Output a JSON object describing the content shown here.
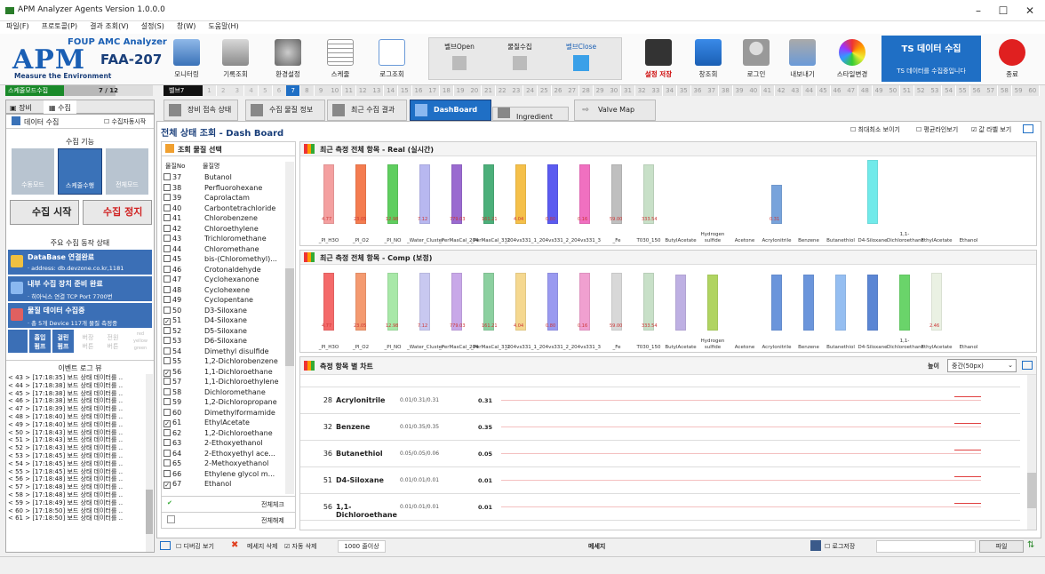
{
  "window": {
    "title": "APM Analyzer Agents Version 1.0.0.0"
  },
  "menu": [
    "파일(F)",
    "프로토콜(P)",
    "결과 조회(V)",
    "설정(S)",
    "창(W)",
    "도움말(H)"
  ],
  "logo": {
    "brand": "APM",
    "foup": "FOUP AMC Analyzer",
    "model": "FAA-207",
    "tagline": "Measure the Environment"
  },
  "toolbar": {
    "monitoring": "모니터링",
    "record": "기록조회",
    "env": "환경설정",
    "schedule": "스케줄",
    "log": "로그조회",
    "valve_open": "벨브Open",
    "mat_collect": "물질수집",
    "valve_close": "벨브Close",
    "save": "설정 저장",
    "window": "창조회",
    "login": "로그인",
    "export": "내보내기",
    "style": "스타일변경",
    "exit": "종료"
  },
  "ts": {
    "title": "TS 데이터 수집",
    "status": "TS 데이터를 수집중입니다"
  },
  "progress": {
    "mode": "스케줄모드수집",
    "count": "7 / 12",
    "fraction": 0.583,
    "valve_label": "벨브7"
  },
  "steps": [
    "1",
    "2",
    "3",
    "4",
    "5",
    "6",
    "7",
    "8",
    "9",
    "10",
    "11",
    "12",
    "13",
    "14",
    "15",
    "16",
    "17",
    "18",
    "19",
    "20",
    "21",
    "22",
    "23",
    "24",
    "25",
    "26",
    "27",
    "28",
    "29",
    "30",
    "31",
    "32",
    "33",
    "34",
    "35",
    "36",
    "37",
    "38",
    "39",
    "40",
    "41",
    "42",
    "43",
    "44",
    "45",
    "46",
    "47",
    "48",
    "49",
    "50",
    "51",
    "52",
    "53",
    "54",
    "55",
    "56",
    "57",
    "58",
    "59",
    "60"
  ],
  "active_step": "7",
  "left_tabs": [
    "장비",
    "수집"
  ],
  "left": {
    "collect_title": "데이터 수집",
    "auto_collect": "수집자동시작",
    "func_title": "수집 기능",
    "modes": [
      "수동모드",
      "스케줄수행",
      "전체모드"
    ],
    "start": "수집 시작",
    "stop": "수집 정지",
    "status_title": "주요 수집 동작 상태",
    "status": [
      {
        "h": "DataBase 연결완료",
        "s": "· address: db.devzone.co.kr,1181"
      },
      {
        "h": "내부 수집 장치 준비 완료",
        "s": "· 히아닉스 연결 TCP Port 7700번"
      },
      {
        "h": "물질 데이터 수집중",
        "s": "· 총 5개 Device 117개 물질 측정중"
      }
    ],
    "pumps": [
      "흡입\n펌프",
      "걸린\n펌프",
      "버장\n버튼",
      "전원\n버튼"
    ],
    "pump_tags": [
      "red",
      "yellow",
      "green"
    ],
    "log_title": "이벤트 로그 뷰",
    "logs": [
      "< 43 > [17:18:35] 보드 상태 데이터를 ..",
      "< 44 > [17:18:38] 보드 상태 데이터를 ..",
      "< 45 > [17:18:38] 보드 상태 데이터를 ..",
      "< 46 > [17:18:38] 보드 상태 데이터를 ..",
      "< 47 > [17:18:39] 보드 상태 데이터를 ..",
      "< 48 > [17:18:40] 보드 상태 데이터를 ..",
      "< 49 > [17:18:40] 보드 상태 데이터를 ..",
      "< 50 > [17:18:43] 보드 상태 데이터를 ..",
      "< 51 > [17:18:43] 보드 상태 데이터를 ..",
      "< 52 > [17:18:43] 보드 상태 데이터를 ..",
      "< 53 > [17:18:45] 보드 상태 데이터를 ..",
      "< 54 > [17:18:45] 보드 상태 데이터를 ..",
      "< 55 > [17:18:45] 보드 상태 데이터를 ..",
      "< 56 > [17:18:48] 보드 상태 데이터를 ..",
      "< 57 > [17:18:48] 보드 상태 데이터를 ..",
      "< 58 > [17:18:48] 보드 상태 데이터를 ..",
      "< 59 > [17:18:49] 보드 상태 데이터를 ..",
      "< 60 > [17:18:50] 보드 상태 데이터를 ..",
      "< 61 > [17:18:50] 보드 상태 데이터를 .."
    ]
  },
  "tabs": [
    "장비 접속 상태",
    "수집 물질 정보",
    "최근 수집 결과",
    "DashBoard",
    "Ingredient",
    "Valve Map"
  ],
  "dash": {
    "title": "전체 상태 조회 - Dash Board",
    "opt_minmax": "최대최소 보이기",
    "opt_avg": "평균라인보기",
    "opt_value": "값 라벨 보기"
  },
  "materials": {
    "title": "조회 물질 선택",
    "col_no": "물질No",
    "col_name": "물질명",
    "check_all": "전체체크",
    "uncheck_all": "전체해제",
    "rows": [
      {
        "no": "37",
        "name": "Butanol",
        "c": false
      },
      {
        "no": "38",
        "name": "Perfluorohexane",
        "c": false
      },
      {
        "no": "39",
        "name": "Caprolactam",
        "c": false
      },
      {
        "no": "40",
        "name": "Carbontetrachloride",
        "c": false
      },
      {
        "no": "41",
        "name": "Chlorobenzene",
        "c": false
      },
      {
        "no": "42",
        "name": "Chloroethylene",
        "c": false
      },
      {
        "no": "43",
        "name": "Trichloromethane",
        "c": false
      },
      {
        "no": "44",
        "name": "Chloromethane",
        "c": false
      },
      {
        "no": "45",
        "name": "bis-(Chloromethyl)...",
        "c": false
      },
      {
        "no": "46",
        "name": "Crotonaldehyde",
        "c": false
      },
      {
        "no": "47",
        "name": "Cyclohexanone",
        "c": false
      },
      {
        "no": "48",
        "name": "Cyclohexene",
        "c": false
      },
      {
        "no": "49",
        "name": "Cyclopentane",
        "c": false
      },
      {
        "no": "50",
        "name": "D3-Siloxane",
        "c": false
      },
      {
        "no": "51",
        "name": "D4-Siloxane",
        "c": true
      },
      {
        "no": "52",
        "name": "D5-Siloxane",
        "c": false
      },
      {
        "no": "53",
        "name": "D6-Siloxane",
        "c": false
      },
      {
        "no": "54",
        "name": "Dimethyl disulfide",
        "c": false
      },
      {
        "no": "55",
        "name": "1,2-Dichlorobenzene",
        "c": false
      },
      {
        "no": "56",
        "name": "1,1-Dichloroethane",
        "c": true
      },
      {
        "no": "57",
        "name": "1,1-Dichloroethylene",
        "c": false
      },
      {
        "no": "58",
        "name": "Dichloromethane",
        "c": false
      },
      {
        "no": "59",
        "name": "1,2-Dichloropropane",
        "c": false
      },
      {
        "no": "60",
        "name": "Dimethylformamide",
        "c": false
      },
      {
        "no": "61",
        "name": "EthylAcetate",
        "c": true
      },
      {
        "no": "62",
        "name": "1,2-Dichloroethane",
        "c": false
      },
      {
        "no": "63",
        "name": "2-Ethoxyethanol",
        "c": false
      },
      {
        "no": "64",
        "name": "2-Ethoxyethyl ace...",
        "c": false
      },
      {
        "no": "65",
        "name": "2-Methoxyethanol",
        "c": false
      },
      {
        "no": "66",
        "name": "Ethylene glycol m...",
        "c": false
      },
      {
        "no": "67",
        "name": "Ethanol",
        "c": true
      }
    ]
  },
  "chart_real": {
    "title": "최근 측정 전체 항목 - Real (실시간)"
  },
  "chart_comp": {
    "title": "최근 측정 전체 항목 - Comp (보정)"
  },
  "chart_data": [
    {
      "type": "bar",
      "title": "최근 측정 전체 항목 - Real (실시간)",
      "categories": [
        "_PI_H3O",
        "_PI_O2",
        "_PI_NO",
        "_Water_Cluster",
        "_PerMasCal_204",
        "_PerMasCal_331",
        "_204vs331_1",
        "_204vs331_2",
        "_204vs331_3",
        "_Fe",
        "T030_150",
        "ButylAcetate",
        "Hydrogen sulfide",
        "Acetone",
        "Acrylonitrile",
        "Benzene",
        "Butanethiol",
        "D4-Siloxane",
        "1,1-Dichloroethane",
        "EthylAcetate",
        "Ethanol"
      ],
      "values": [
        4.77,
        23.05,
        12.98,
        7.12,
        779.03,
        161.21,
        4.04,
        0.8,
        0.16,
        59.0,
        333.54,
        null,
        null,
        null,
        0.31,
        null,
        null,
        null,
        null,
        null,
        null
      ],
      "value_labels": [
        "4.77",
        "23.05",
        "12.98",
        "7.12",
        "779.03",
        "161.21",
        "4.04",
        "0.80",
        "0.16",
        "59.00",
        "333.54",
        "",
        "",
        "",
        "0.31",
        "",
        "",
        "",
        "",
        "",
        ""
      ],
      "colors": [
        "#f4a0a0",
        "#f47c50",
        "#5fce5f",
        "#b8b8f0",
        "#9a6ad0",
        "#4caf7a",
        "#f5c04a",
        "#5b5bf0",
        "#f070c0",
        "#bfbfbf",
        "#c8e0c8",
        "#ffffff",
        "#ffffff",
        "#ffffff",
        "#6a9ad8",
        "#ffffff",
        "#ffffff",
        "#62e8e8",
        "#ffffff",
        "#ffffff",
        "#ffffff"
      ]
    },
    {
      "type": "bar",
      "title": "최근 측정 전체 항목 - Comp (보정)",
      "categories": [
        "_PI_H3O",
        "_PI_O2",
        "_PI_NO",
        "_Water_Cluster",
        "_PerMasCal_204",
        "_PerMasCal_331",
        "_204vs331_1",
        "_204vs331_2",
        "_204vs331_3",
        "_Fe",
        "T030_150",
        "ButylAcetate",
        "Hydrogen sulfide",
        "Acetone",
        "Acrylonitrile",
        "Benzene",
        "Butanethiol",
        "D4-Siloxane",
        "1,1-Dichloroethane",
        "EthylAcetate",
        "Ethanol"
      ],
      "values": [
        4.77,
        23.05,
        12.98,
        7.12,
        779.03,
        161.21,
        4.04,
        0.8,
        0.16,
        59.0,
        333.54,
        null,
        null,
        null,
        null,
        null,
        null,
        null,
        null,
        2.46,
        null
      ],
      "value_labels": [
        "4.77",
        "23.05",
        "12.98",
        "7.12",
        "779.03",
        "161.21",
        "4.04",
        "0.80",
        "0.16",
        "59.00",
        "333.54",
        "",
        "",
        "",
        "",
        "",
        "",
        "",
        "",
        "2.46",
        ""
      ],
      "colors": [
        "#f46a6a",
        "#f49a70",
        "#a8e8a8",
        "#c8c8f0",
        "#c8a8e8",
        "#8cd0a0",
        "#f5d890",
        "#9a9af0",
        "#f0a0d0",
        "#d8d8d8",
        "#c8e0c8",
        "#b8a8e0",
        "#a8d050",
        "#ffffff",
        "#5b8ad8",
        "#5b8ad8",
        "#8ab8f0",
        "#4a7ad0",
        "#5ad05a",
        "#e8f0e0",
        "#ffffff"
      ]
    }
  ],
  "item_chart": {
    "title": "측정 항목 별 차트",
    "height_label": "높이",
    "height_value": "중간(50px)",
    "rows": [
      {
        "no": "28",
        "name": "Acrylonitrile",
        "th": "0.01/0.31/0.31",
        "v": "0.31"
      },
      {
        "no": "32",
        "name": "Benzene",
        "th": "0.01/0.35/0.35",
        "v": "0.35"
      },
      {
        "no": "36",
        "name": "Butanethiol",
        "th": "0.05/0.05/0.06",
        "v": "0.05"
      },
      {
        "no": "51",
        "name": "D4-Siloxane",
        "th": "0.01/0.01/0.01",
        "v": "0.01"
      },
      {
        "no": "56",
        "name": "1,1-Dichloroethane",
        "th": "0.01/0.01/0.01",
        "v": "0.01"
      }
    ]
  },
  "bottom": {
    "debug": "디버깅 보기",
    "delete_msg": "메세지 삭제",
    "auto_delete": "자동 삭제",
    "line_limit": "1000 줄이상",
    "message": "메세지",
    "log_save": "로그저장",
    "file": "파일"
  }
}
